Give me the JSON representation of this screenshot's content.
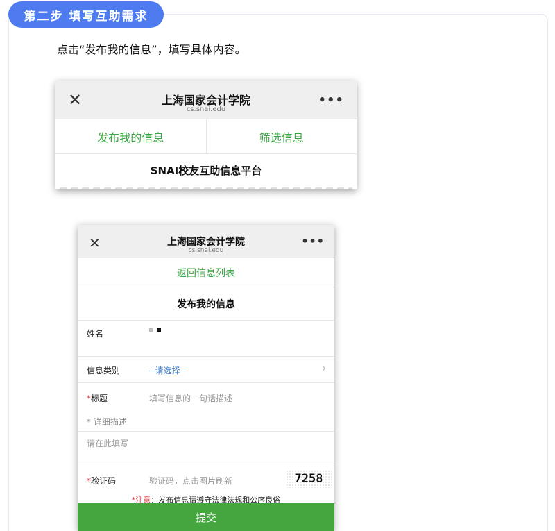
{
  "step_badge": "第二步 填写互助需求",
  "instruction": "点击“发布我的信息”，填写具体内容。",
  "shot1": {
    "title": "上海国家会计学院",
    "url": "cs.snai.edu",
    "close_icon": "close-icon",
    "more_icon": "more-icon",
    "tabs": [
      {
        "label": "发布我的信息"
      },
      {
        "label": "筛选信息"
      }
    ],
    "platform_title": "SNAI校友互助信息平台"
  },
  "shot2": {
    "title": "上海国家会计学院",
    "url": "cs.snai.edu",
    "back_link": "返回信息列表",
    "form_title": "发布我的信息",
    "fields": {
      "name_label": "姓名",
      "category_label": "信息类别",
      "category_value": "--请选择--",
      "title_required": "*",
      "title_label": "标题",
      "title_placeholder": "填写信息的一句话描述",
      "detail_label": "* 详细描述",
      "detail_placeholder": "请在此填写",
      "captcha_required": "*",
      "captcha_label": "验证码",
      "captcha_placeholder": "验证码，点击图片刷新",
      "captcha_code": "7258"
    },
    "notice_prefix": "*注意",
    "notice_text": "：发布信息请遵守法律法规和公序良俗",
    "submit_label": "提交"
  },
  "colors": {
    "badge": "#4e7cf0",
    "accent_green": "#3aa544",
    "submit_green": "#45a640",
    "link_blue": "#3c7fc0",
    "required_red": "#d9363e"
  }
}
